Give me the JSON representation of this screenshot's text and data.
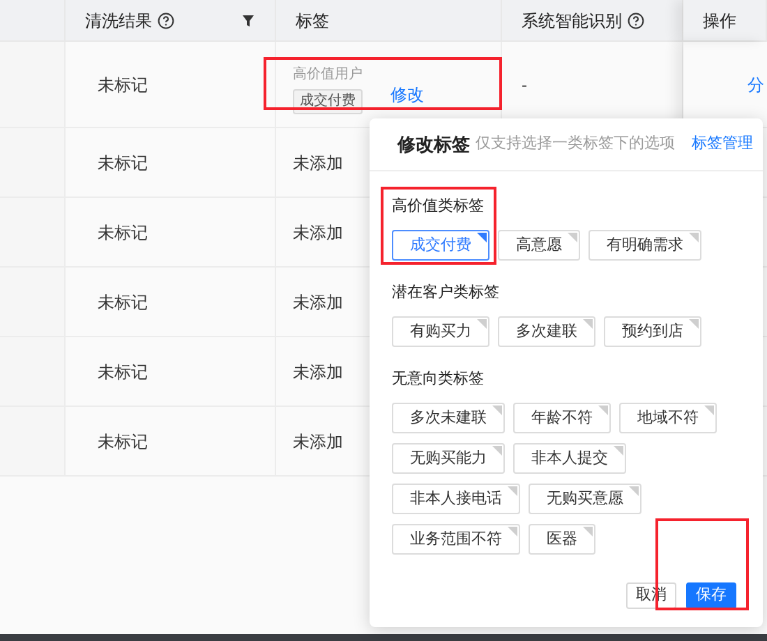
{
  "table": {
    "columns": [
      {
        "label": "清洗结果",
        "help": true,
        "filter": true
      },
      {
        "label": "标签"
      },
      {
        "label": "系统智能识别",
        "help": true
      },
      {
        "label": "操作"
      }
    ],
    "rows": [
      {
        "clean_result": "未标记",
        "tag_group": "高价值用户",
        "tag": "成交付费",
        "tag_action": "修改",
        "tags_highlighted": true,
        "system": "-",
        "action": "分"
      },
      {
        "clean_result": "未标记",
        "tag_empty": "未添加"
      },
      {
        "clean_result": "未标记",
        "tag_empty": "未添加"
      },
      {
        "clean_result": "未标记",
        "tag_empty": "未添加"
      },
      {
        "clean_result": "未标记",
        "tag_empty": "未添加"
      },
      {
        "clean_result": "未标记",
        "tag_empty": "未添加"
      }
    ]
  },
  "dialog": {
    "title": "修改标签",
    "hint": "仅支持选择一类标签下的选项",
    "manage_link": "标签管理",
    "groups": [
      {
        "title": "高价值类标签",
        "highlighted": true,
        "tags": [
          {
            "label": "成交付费",
            "selected": true
          },
          {
            "label": "高意愿",
            "selected": false
          },
          {
            "label": "有明确需求",
            "selected": false
          }
        ]
      },
      {
        "title": "潜在客户类标签",
        "tags": [
          {
            "label": "有购买力",
            "selected": false
          },
          {
            "label": "多次建联",
            "selected": false
          },
          {
            "label": "预约到店",
            "selected": false
          }
        ]
      },
      {
        "title": "无意向类标签",
        "tags": [
          {
            "label": "多次未建联",
            "selected": false
          },
          {
            "label": "年龄不符",
            "selected": false
          },
          {
            "label": "地域不符",
            "selected": false
          },
          {
            "label": "无购买能力",
            "selected": false
          },
          {
            "label": "非本人提交",
            "selected": false
          },
          {
            "label": "非本人接电话",
            "selected": false
          },
          {
            "label": "无购买意愿",
            "selected": false
          },
          {
            "label": "业务范围不符",
            "selected": false
          },
          {
            "label": "医器",
            "selected": false
          }
        ]
      }
    ],
    "cancel": "取消",
    "save": "保存",
    "footer_highlighted": true
  }
}
